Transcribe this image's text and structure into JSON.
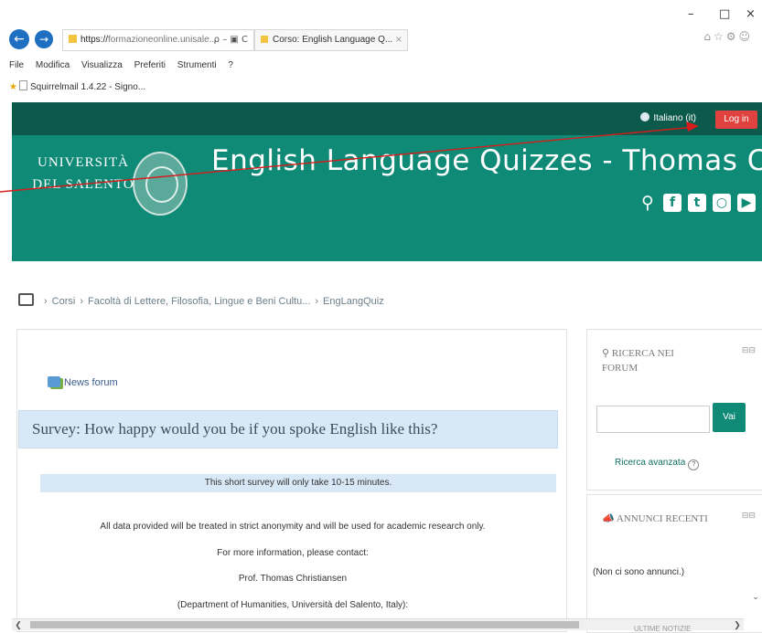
{
  "browser": {
    "back_icon": "back-arrow-icon",
    "forward_icon": "forward-arrow-icon",
    "address_prefix": "https://",
    "address_host": "formazioneonline.unisale...",
    "address_controls": "ρ – ▣ C",
    "tab_label": "Corso: English Language Q...",
    "tab_close": "×",
    "window_minimize": "–",
    "window_maximize": "□",
    "window_close": "×",
    "menu": [
      "File",
      "Modifica",
      "Visualizza",
      "Preferiti",
      "Strumenti",
      "?"
    ],
    "favorite_label": "Squirrelmail 1.4.22 - Signo..."
  },
  "topbar": {
    "language": "Italiano (it)",
    "login": "Log in"
  },
  "banner": {
    "university_line1": "UNIVERSITÀ",
    "university_line2": "DEL SALENTO",
    "course_title": "English Language Quizzes - Thomas Chr"
  },
  "breadcrumb": {
    "items": [
      "Corsi",
      "Facoltà di Lettere, Filosofia, Lingue e Beni Cultu...",
      "EngLangQuiz"
    ],
    "separator": "›"
  },
  "main": {
    "news_forum": "News forum",
    "survey_title": "Survey: How happy would you be if you spoke English like this?",
    "note": "This short survey will only take 10-15 minutes.",
    "lines": [
      "All data provided will be treated in strict anonymity and will be used for academic research only.",
      "For more information, please contact:",
      "Prof. Thomas Christiansen",
      "(Department of Humanities, Università del Salento, Italy):"
    ]
  },
  "block_forum": {
    "title": "RICERCA NEI FORUM",
    "search_value": "",
    "go_label": "Vai",
    "advanced": "Ricerca avanzata"
  },
  "block_news": {
    "title": "ANNUNCI RECENTI",
    "empty": "(Non ci sono annunci.)"
  },
  "partial_block_title": "ULTIME NOTIZIE",
  "colors": {
    "navbar": "#0b5a4c",
    "banner": "#0f8a77",
    "login": "#e0433f",
    "survey_bg": "#d9e8f6",
    "annotation": "#d61c1c"
  }
}
